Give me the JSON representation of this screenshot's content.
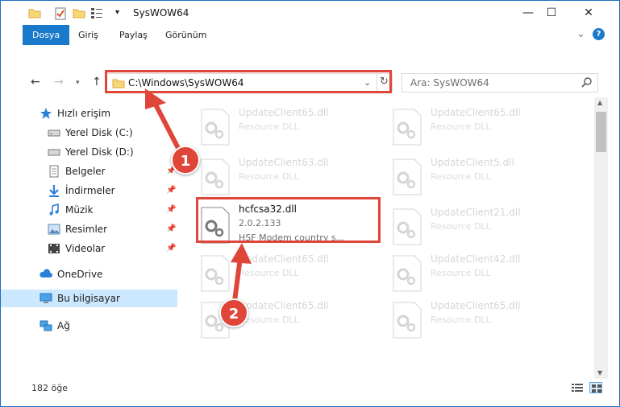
{
  "window": {
    "title": "SysWOW64",
    "minimize": "—",
    "maximize": "☐",
    "close": "✕"
  },
  "ribbon": {
    "tabs": [
      {
        "label": "Dosya",
        "active": true
      },
      {
        "label": "Giriş"
      },
      {
        "label": "Paylaş"
      },
      {
        "label": "Görünüm"
      }
    ],
    "expand": "⌄",
    "help": "?"
  },
  "nav": {
    "address": "C:\\Windows\\SysWOW64",
    "search_placeholder": "Ara: SysWOW64"
  },
  "sidebar": {
    "items": [
      {
        "label": "Hızlı erişim",
        "icon": "star-icon"
      },
      {
        "label": "Yerel Disk (C:)",
        "icon": "drive-icon"
      },
      {
        "label": "Yerel Disk (D:)",
        "icon": "drive-icon"
      },
      {
        "label": "Belgeler",
        "icon": "documents-icon"
      },
      {
        "label": "İndirmeler",
        "icon": "download-icon"
      },
      {
        "label": "Müzik",
        "icon": "music-icon"
      },
      {
        "label": "Resimler",
        "icon": "pictures-icon"
      },
      {
        "label": "Videolar",
        "icon": "videos-icon"
      },
      {
        "label": "OneDrive",
        "icon": "cloud-icon"
      },
      {
        "label": "Bu bilgisayar",
        "icon": "computer-icon"
      },
      {
        "label": "Ağ",
        "icon": "network-icon"
      }
    ]
  },
  "files": [
    {
      "name": "UpdateClient65.dll",
      "desc": "Resource DLL"
    },
    {
      "name": "UpdateClient65.dll",
      "desc": "Resource DLL"
    },
    {
      "name": "UpdateClient63.dll",
      "desc": "Resource DLL"
    },
    {
      "name": "UpdateClient5.dll",
      "desc": "Resource DLL"
    },
    {
      "name": "hcfcsa32.dll",
      "version": "2.0.2.133",
      "desc": "HSF Modem country s..."
    },
    {
      "name": "UpdateClient21.dll",
      "desc": "Resource DLL"
    },
    {
      "name": "UpdateClient65.dll",
      "desc": "Resource DLL"
    },
    {
      "name": "UpdateClient42.dll",
      "desc": "Resource DLL"
    },
    {
      "name": "UpdateClient65.dll",
      "desc": "Resource DLL"
    },
    {
      "name": "UpdateClient65.dll",
      "desc": "Resource DLL"
    }
  ],
  "status": {
    "count": "182 öğe"
  },
  "annotations": {
    "step1": "1",
    "step2": "2",
    "color": "#e0453a"
  }
}
